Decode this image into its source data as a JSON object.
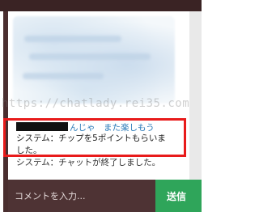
{
  "chat": {
    "messages": [
      {
        "name_redacted": true,
        "text": "んじゃ　また楽しもう"
      },
      {
        "text": "システム：チップを5ポイントもらいました。"
      },
      {
        "text": "システム：チャットが終了しました。"
      }
    ]
  },
  "watermark": "https://chatlady.rei35.com",
  "input": {
    "placeholder": "コメントを入力..."
  },
  "send_label": "送信",
  "colors": {
    "highlight": "#e81b1b",
    "send": "#2fa55a",
    "link_text": "#2a7ab8",
    "frame": "#4a2e2f"
  }
}
